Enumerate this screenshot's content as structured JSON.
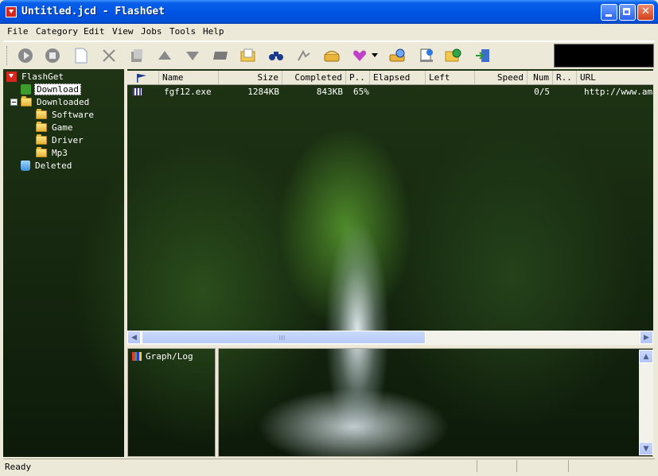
{
  "window": {
    "title": "Untitled.jcd - FlashGet"
  },
  "menu": [
    {
      "label": "File"
    },
    {
      "label": "Category"
    },
    {
      "label": "Edit"
    },
    {
      "label": "View"
    },
    {
      "label": "Jobs"
    },
    {
      "label": "Tools"
    },
    {
      "label": "Help"
    }
  ],
  "toolbar": {
    "buttons": [
      "start-icon",
      "pause-icon",
      "new-job-icon",
      "delete-icon",
      "properties-icon",
      "move-up-icon",
      "move-down-icon",
      "category-icon",
      "open-folder-icon",
      "search-icon",
      "site-explorer-icon",
      "dial-icon",
      "speed-mode-icon",
      "speed-dropdown-icon",
      "scheduler-icon",
      "options-icon",
      "web-icon",
      "exit-icon"
    ]
  },
  "tree": {
    "root": "FlashGet",
    "download": "Download",
    "downloaded": "Downloaded",
    "subfolders": [
      "Software",
      "Game",
      "Driver",
      "Mp3"
    ],
    "deleted": "Deleted"
  },
  "list": {
    "columns": [
      "Name",
      "Size",
      "Completed",
      "P..",
      "Elapsed",
      "Left",
      "Speed",
      "Num",
      "R..",
      "URL"
    ],
    "rows": [
      {
        "name": "fgf12.exe",
        "size": "1284KB",
        "completed": "843KB",
        "percent": "65%",
        "elapsed": "",
        "left": "",
        "speed": "",
        "num": "0/5",
        "r": "",
        "url": "http://www.amaz"
      }
    ]
  },
  "bottom": {
    "graph_tab": "Graph/Log"
  },
  "status": {
    "text": "Ready"
  },
  "colors": {
    "titlebar": "#0055e5",
    "chrome": "#ece9d8"
  }
}
